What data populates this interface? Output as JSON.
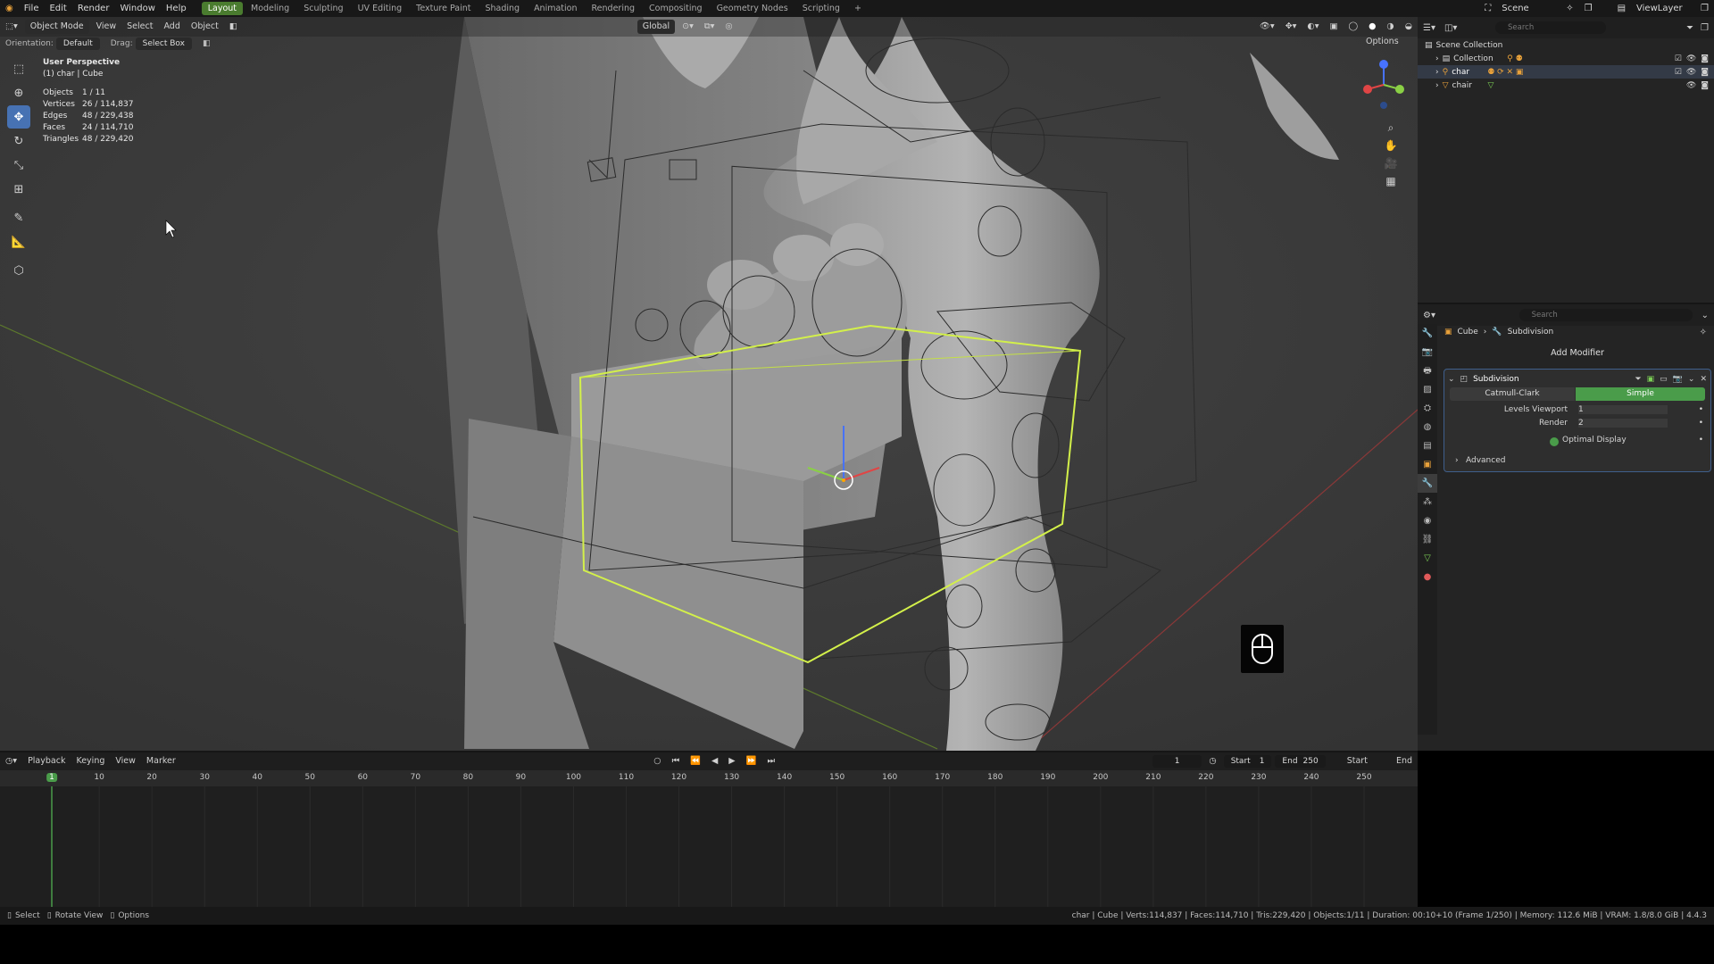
{
  "menu": {
    "items": [
      "File",
      "Edit",
      "Render",
      "Window",
      "Help"
    ],
    "workspaces": [
      "Layout",
      "Modeling",
      "Sculpting",
      "UV Editing",
      "Texture Paint",
      "Shading",
      "Animation",
      "Rendering",
      "Compositing",
      "Geometry Nodes",
      "Scripting"
    ],
    "active_workspace": "Layout",
    "scene_label": "Scene",
    "viewlayer_label": "ViewLayer"
  },
  "viewport": {
    "mode": "Object Mode",
    "menus": [
      "View",
      "Select",
      "Add",
      "Object"
    ],
    "transform_space": "Global",
    "orientation_label": "Orientation:",
    "orientation_value": "Default",
    "drag_label": "Drag:",
    "drag_value": "Select Box",
    "options_label": "Options",
    "perspective": "User Perspective",
    "context": "(1) char | Cube",
    "stats": [
      {
        "key": "Objects",
        "value": "1 / 11"
      },
      {
        "key": "Vertices",
        "value": "26 / 114,837"
      },
      {
        "key": "Edges",
        "value": "48 / 229,438"
      },
      {
        "key": "Faces",
        "value": "24 / 114,710"
      },
      {
        "key": "Triangles",
        "value": "48 / 229,420"
      }
    ]
  },
  "outliner": {
    "search_placeholder": "Search",
    "root": "Scene Collection",
    "rows": [
      "Collection",
      "char",
      "chair"
    ]
  },
  "properties": {
    "search_placeholder": "Search",
    "breadcrumb_object": "Cube",
    "breadcrumb_modifier": "Subdivision",
    "add_modifier": "Add Modifier",
    "modifier_name": "Subdivision",
    "mode_a": "Catmull-Clark",
    "mode_b": "Simple",
    "active_mode": "Simple",
    "levels_viewport_label": "Levels Viewport",
    "levels_viewport_value": "1",
    "render_label": "Render",
    "render_value": "2",
    "optimal_display_label": "Optimal Display",
    "optimal_display_checked": true,
    "advanced_label": "Advanced"
  },
  "timeline": {
    "menus": [
      "Playback",
      "Keying",
      "View",
      "Marker"
    ],
    "current_frame": "1",
    "start_label": "Start",
    "start_value": "1",
    "end_label": "End",
    "end_value": "250",
    "right_start": "Start",
    "right_end": "End",
    "ticks": [
      "1",
      "10",
      "20",
      "30",
      "40",
      "50",
      "60",
      "70",
      "80",
      "90",
      "100",
      "110",
      "120",
      "130",
      "140",
      "150",
      "160",
      "170",
      "180",
      "190",
      "200",
      "210",
      "220",
      "230",
      "240",
      "250"
    ]
  },
  "status": {
    "left_items": [
      "Select",
      "Rotate View",
      "Options"
    ],
    "info": "char | Cube | Verts:114,837 | Faces:114,710 | Tris:229,420 | Objects:1/11 | Duration: 00:10+10 (Frame 1/250) | Memory: 112.6 MiB | VRAM: 1.8/8.0 GiB | 4.4.3"
  },
  "colors": {
    "accent_blue": "#4772b3",
    "active_green": "#4a7c2f",
    "selection_outline": "#d3f04a"
  }
}
